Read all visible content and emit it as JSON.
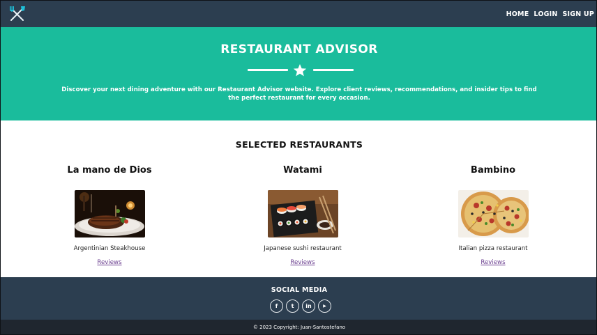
{
  "navbar": {
    "logo_icon": "fork-knife-icon",
    "links": [
      "HOME",
      "LOGIN",
      "SIGN UP"
    ]
  },
  "hero": {
    "title": "RESTAURANT ADVISOR",
    "divider_icon": "star-icon",
    "description": "Discover your next dining adventure with our Restaurant Advisor website. Explore client reviews, recommendations, and insider tips to find the perfect restaurant for every occasion."
  },
  "main": {
    "section_title": "SELECTED RESTAURANTS",
    "restaurants": [
      {
        "name": "La mano de Dios",
        "description": "Argentinian Steakhouse",
        "link": "Reviews"
      },
      {
        "name": "Watami",
        "description": "Japanese sushi restaurant",
        "link": "Reviews"
      },
      {
        "name": "Bambino",
        "description": "Italian pizza restaurant",
        "link": "Reviews"
      }
    ]
  },
  "social": {
    "title": "SOCIAL MEDIA",
    "icons": [
      {
        "name": "facebook-icon",
        "glyph": "f"
      },
      {
        "name": "twitter-icon",
        "glyph": "t"
      },
      {
        "name": "linkedin-icon",
        "glyph": "in"
      },
      {
        "name": "youtube-icon",
        "glyph": "▶"
      }
    ]
  },
  "footer": {
    "copyright": "© 2023 Copyright: Juan-Santostefano"
  },
  "colors": {
    "nav_bg": "#2c3e50",
    "hero_bg": "#1abc9c",
    "copyright_bg": "#1f262f",
    "link": "#6a3e8f"
  }
}
